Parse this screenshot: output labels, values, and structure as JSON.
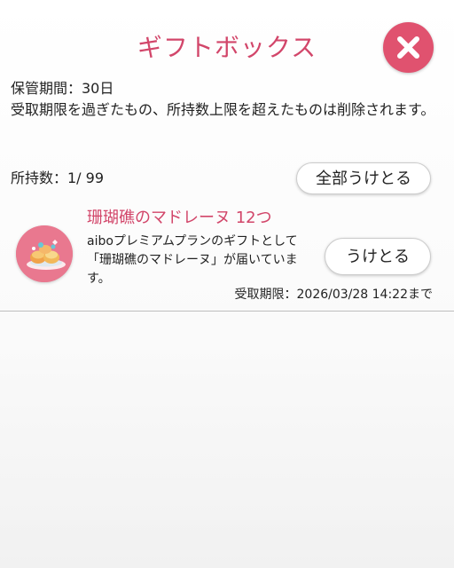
{
  "header": {
    "title": "ギフトボックス",
    "close_icon": "close-icon",
    "close_color": "#e0526f",
    "title_color": "#d2466a"
  },
  "info": {
    "storage_period": "保管期間：30日",
    "notice": "受取期限を過ぎたもの、所持数上限を超えたものは削除されます。"
  },
  "count": {
    "label": "所持数：1/ 99",
    "receive_all_label": "全部うけとる"
  },
  "gifts": [
    {
      "name": "珊瑚礁のマドレーヌ 12つ",
      "thumbnail_icon": "madeleine-icon",
      "description": "aiboプレミアムプランのギフトとして「珊瑚礁のマドレーヌ」が届いています。",
      "receive_label": "うけとる",
      "deadline": "受取期限：2026/03/28 14:22まで"
    }
  ]
}
